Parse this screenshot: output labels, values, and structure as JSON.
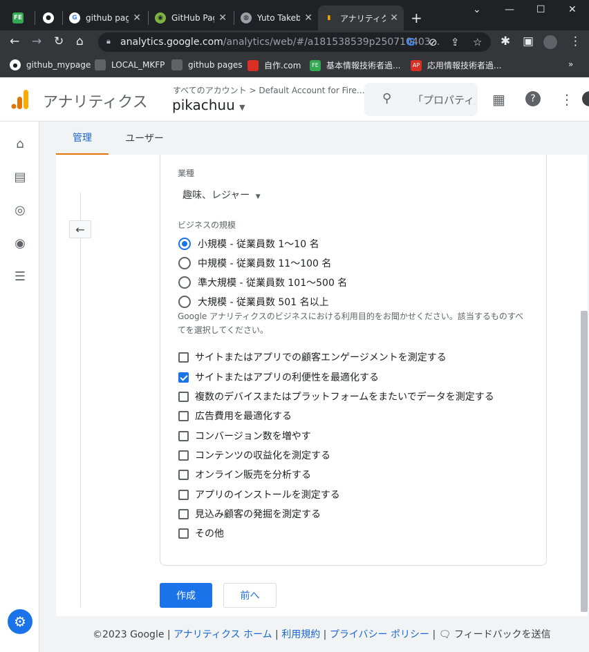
{
  "browser": {
    "tabs": [
      {
        "title": "",
        "favicon": "spreadsheet-icon"
      },
      {
        "title": "",
        "favicon": "github-icon"
      },
      {
        "title": "github pag",
        "favicon": "google-icon"
      },
      {
        "title": "GitHub Pag",
        "favicon": "lime-icon"
      },
      {
        "title": "Yuto Takeb",
        "favicon": "globe-icon"
      },
      {
        "title": "アナリティクス",
        "favicon": "analytics-icon"
      }
    ],
    "url_host": "analytics.google.com",
    "url_path": "/analytics/web/#/a181538539p250710403...",
    "bookmarks": [
      {
        "label": "github_mypage",
        "icon": "github-icon"
      },
      {
        "label": "LOCAL_MKFP",
        "icon": "image-icon"
      },
      {
        "label": "github pages",
        "icon": "image-icon"
      },
      {
        "label": "自作.com",
        "icon": "calendar-icon"
      },
      {
        "label": "基本情報技術者過...",
        "icon": "fe-icon"
      },
      {
        "label": "応用情報技術者過...",
        "icon": "ap-icon"
      }
    ],
    "more_bookmarks": "»"
  },
  "header": {
    "app_name": "アナリティクス",
    "breadcrumb": "すべてのアカウント > Default Account for Fire...",
    "property": "pikachuu",
    "search_placeholder": "「プロパティ」",
    "accent": "#e37400"
  },
  "tabs": {
    "admin": "管理",
    "user": "ユーザー"
  },
  "form": {
    "industry_label": "業種",
    "industry_value": "趣味、レジャー",
    "size_label": "ビジネスの規模",
    "sizes": [
      {
        "label": "小規模 - 従業員数 1～10 名",
        "selected": true
      },
      {
        "label": "中規模 - 従業員数 11～100 名",
        "selected": false
      },
      {
        "label": "準大規模 - 従業員数 101～500 名",
        "selected": false
      },
      {
        "label": "大規模 - 従業員数 501 名以上",
        "selected": false
      }
    ],
    "purpose_desc": "Google アナリティクスのビジネスにおける利用目的をお聞かせください。該当するものすべてを選択してください。",
    "purposes": [
      {
        "label": "サイトまたはアプリでの顧客エンゲージメントを測定する",
        "checked": false
      },
      {
        "label": "サイトまたはアプリの利便性を最適化する",
        "checked": true
      },
      {
        "label": "複数のデバイスまたはプラットフォームをまたいでデータを測定する",
        "checked": false
      },
      {
        "label": "広告費用を最適化する",
        "checked": false
      },
      {
        "label": "コンバージョン数を増やす",
        "checked": false
      },
      {
        "label": "コンテンツの収益化を測定する",
        "checked": false
      },
      {
        "label": "オンライン販売を分析する",
        "checked": false
      },
      {
        "label": "アプリのインストールを測定する",
        "checked": false
      },
      {
        "label": "見込み顧客の発掘を測定する",
        "checked": false
      },
      {
        "label": "その他",
        "checked": false
      }
    ],
    "create_label": "作成",
    "prev_label": "前へ"
  },
  "footer": {
    "copyright": "©2023 Google",
    "home": "アナリティクス ホーム",
    "terms": "利用規約",
    "privacy": "プライバシー ポリシー",
    "feedback": "フィードバックを送信"
  }
}
